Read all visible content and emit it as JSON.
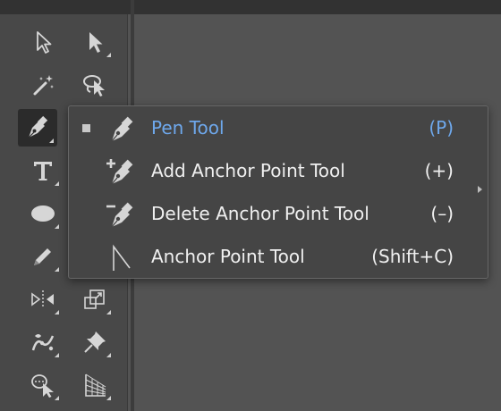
{
  "toolbar": {
    "tools": [
      {
        "name": "selection-tool",
        "icon": "arrow-outline-icon"
      },
      {
        "name": "direct-selection-tool",
        "icon": "arrow-filled-icon"
      },
      {
        "name": "magic-wand-tool",
        "icon": "magic-wand-icon"
      },
      {
        "name": "lasso-tool",
        "icon": "lasso-icon"
      },
      {
        "name": "pen-tool",
        "icon": "pen-icon",
        "active": true
      },
      {
        "name": "curvature-tool",
        "icon": "curvature-icon"
      },
      {
        "name": "type-tool",
        "icon": "type-icon"
      },
      {
        "name": "line-tool",
        "icon": "line-segment-icon"
      },
      {
        "name": "ellipse-tool",
        "icon": "ellipse-icon"
      },
      {
        "name": "paintbrush-tool",
        "icon": "paintbrush-icon"
      },
      {
        "name": "pencil-tool",
        "icon": "pencil-icon"
      },
      {
        "name": "eraser-tool",
        "icon": "eraser-icon"
      },
      {
        "name": "reflect-tool",
        "icon": "reflect-icon"
      },
      {
        "name": "scale-tool",
        "icon": "scale-icon"
      },
      {
        "name": "puppet-warp-tool",
        "icon": "puppet-warp-icon"
      },
      {
        "name": "pin-tool",
        "icon": "pin-icon"
      },
      {
        "name": "shape-builder-tool",
        "icon": "shape-builder-icon"
      },
      {
        "name": "perspective-grid-tool",
        "icon": "perspective-grid-icon"
      }
    ]
  },
  "flyout": {
    "items": [
      {
        "label": "Pen Tool",
        "shortcut": "(P)",
        "icon": "pen-icon",
        "selected": true
      },
      {
        "label": "Add Anchor Point Tool",
        "shortcut": "(+)",
        "icon": "add-anchor-point-icon"
      },
      {
        "label": "Delete Anchor Point Tool",
        "shortcut": "(–)",
        "icon": "delete-anchor-point-icon"
      },
      {
        "label": "Anchor Point Tool",
        "shortcut": "(Shift+C)",
        "icon": "anchor-point-icon"
      }
    ],
    "colors": {
      "selected_text": "#6ea8ec",
      "text": "#f0f0f0",
      "background": "#454545"
    }
  }
}
